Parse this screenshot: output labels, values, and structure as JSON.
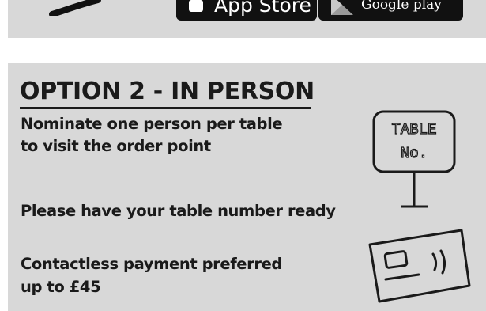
{
  "top_panel": {
    "app_store_label": "App Store",
    "google_play_label": "Google play"
  },
  "option2": {
    "heading": "OPTION 2 - IN PERSON",
    "line1": "Nominate one person per table",
    "line2": "to visit the order point",
    "line3": "Please have your table number ready",
    "line4": "Contactless payment preferred",
    "line5": "up to £45",
    "table_sign_line1": "TABLE",
    "table_sign_line2": "No."
  },
  "icons": [
    "hand-swoosh-icon",
    "apple-icon",
    "google-play-icon",
    "table-number-sign-icon",
    "contactless-card-icon"
  ],
  "colors": {
    "panel": "#d8d8d8",
    "text": "#1a1a1a",
    "badge": "#111111"
  }
}
